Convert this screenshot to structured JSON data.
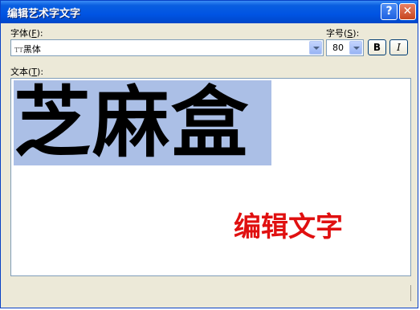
{
  "window": {
    "title": "编辑艺术字文字"
  },
  "titlebar_buttons": {
    "help": "?",
    "close": "✕"
  },
  "font": {
    "label": "字体",
    "accel": "F",
    "value": "黑体",
    "icon": "truetype-font-icon",
    "icon_glyph": "TT"
  },
  "size": {
    "label": "字号",
    "accel": "S",
    "value": "80"
  },
  "format": {
    "bold": "B",
    "italic": "I"
  },
  "text": {
    "label": "文本",
    "accel": "T",
    "content": "芝麻盒"
  },
  "annotation": "编辑文字",
  "colors": {
    "titlebar": "#0054e3",
    "selection": "#abbfe6",
    "annotation": "#e01010"
  }
}
